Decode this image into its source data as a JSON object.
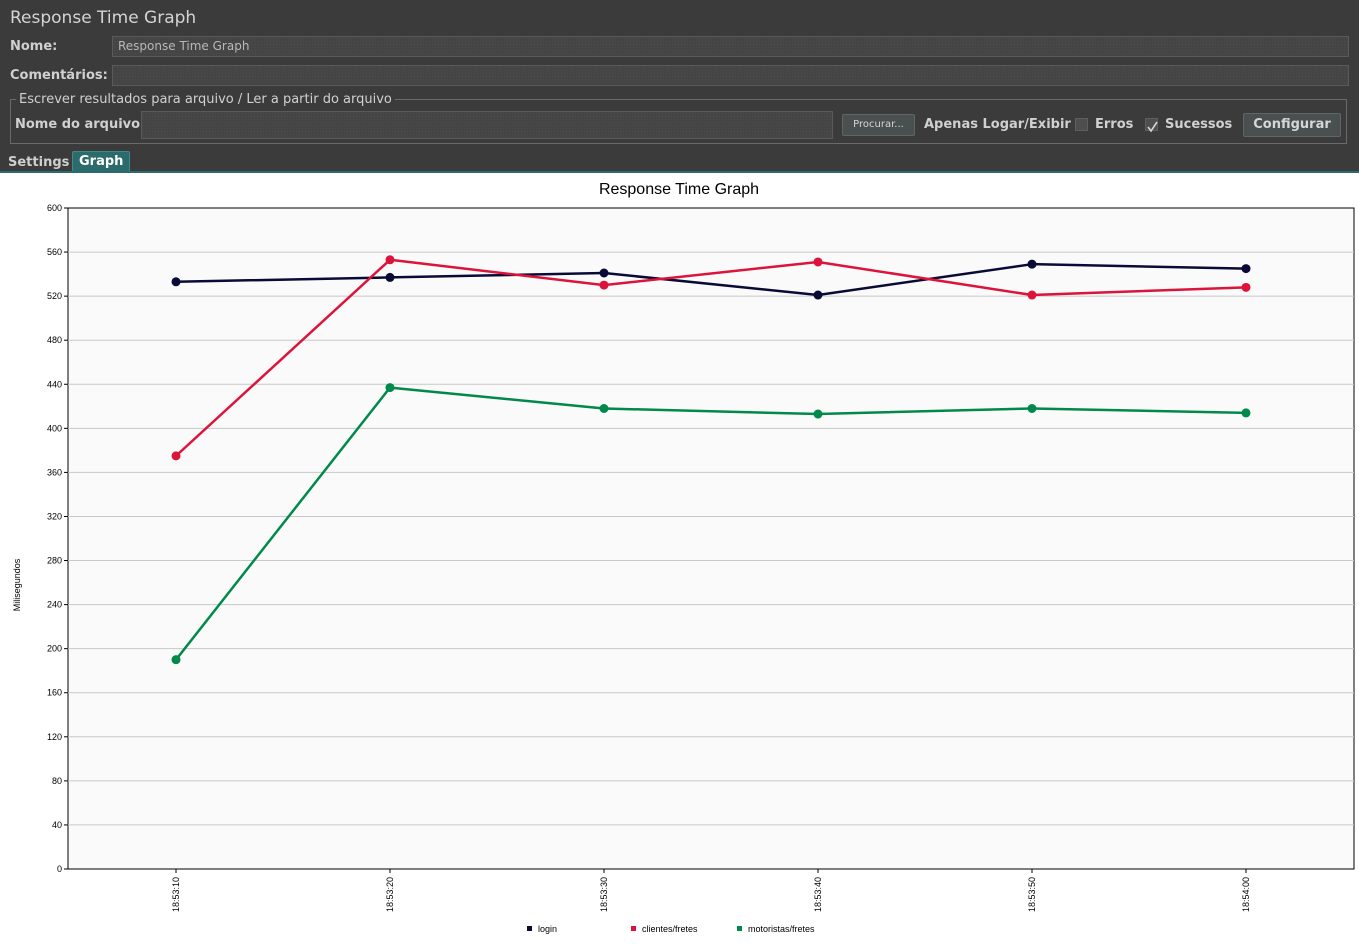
{
  "panel": {
    "title": "Response Time Graph"
  },
  "form": {
    "name_label": "Nome:",
    "name_value": "Response Time Graph",
    "comments_label": "Comentários:",
    "comments_value": ""
  },
  "file": {
    "legend": "Escrever resultados para arquivo / Ler a partir do arquivo",
    "filename_label": "Nome do arquivo",
    "filename_value": "",
    "browse_label": "Procurar...",
    "log_only_label": "Apenas Logar/Exibir",
    "errors_label": "Erros",
    "errors_checked": false,
    "successes_label": "Sucessos",
    "successes_checked": true,
    "configure_label": "Configurar"
  },
  "tabs": [
    {
      "label": "Settings",
      "active": false
    },
    {
      "label": "Graph",
      "active": true
    }
  ],
  "icons": {
    "checkbox": "checkbox-icon",
    "checkmark": "checkmark-icon"
  },
  "colors": {
    "login": "#0a0a36",
    "clientes_fretes": "#dc143c",
    "motoristas_fretes": "#00894a",
    "accent_tab": "#2c6b6b"
  },
  "chart_data": {
    "type": "line",
    "title": "Response Time Graph",
    "xlabel": "",
    "ylabel": "Milisegundos",
    "ylim": [
      0,
      600
    ],
    "yticks": [
      0,
      40,
      80,
      120,
      160,
      200,
      240,
      280,
      320,
      360,
      400,
      440,
      480,
      520,
      560,
      600
    ],
    "categories": [
      "18:53:10",
      "18:53:20",
      "18:53:30",
      "18:53:40",
      "18:53:50",
      "18:54:00"
    ],
    "grid": true,
    "legend_position": "bottom",
    "series": [
      {
        "name": "login",
        "color": "#0a0a36",
        "values": [
          533,
          537,
          541,
          521,
          549,
          545
        ]
      },
      {
        "name": "clientes/fretes",
        "color": "#dc143c",
        "values": [
          375,
          553,
          530,
          551,
          521,
          528
        ]
      },
      {
        "name": "motoristas/fretes",
        "color": "#00894a",
        "values": [
          190,
          437,
          418,
          413,
          418,
          414
        ]
      }
    ]
  }
}
